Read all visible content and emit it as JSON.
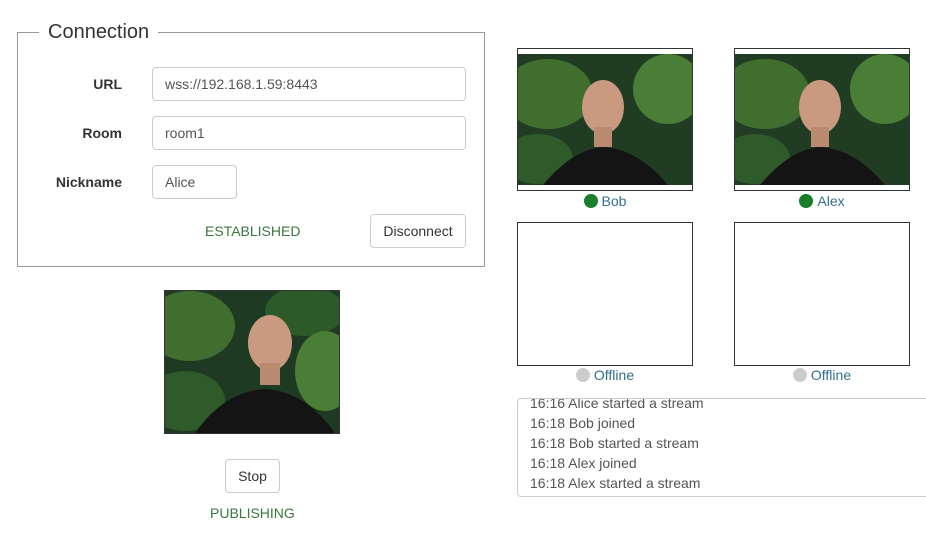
{
  "connection": {
    "legend": "Connection",
    "url_label": "URL",
    "url_value": "wss://192.168.1.59:8443",
    "room_label": "Room",
    "room_value": "room1",
    "nickname_label": "Nickname",
    "nickname_value": "Alice",
    "status": "ESTABLISHED",
    "disconnect_label": "Disconnect"
  },
  "local": {
    "stop_label": "Stop",
    "status": "PUBLISHING"
  },
  "participants": [
    {
      "name": "Bob",
      "state": "online"
    },
    {
      "name": "Alex",
      "state": "online"
    },
    {
      "name": "Offline",
      "state": "offline"
    },
    {
      "name": "Offline",
      "state": "offline"
    }
  ],
  "log": [
    "16:16 Alice started a stream",
    "16:18 Bob joined",
    "16:18 Bob started a stream",
    "16:18 Alex joined",
    "16:18 Alex started a stream"
  ],
  "colors": {
    "status_green": "#3c763d",
    "online_dot": "#1a7f2a",
    "offline_dot": "#cccccc",
    "participant_text": "#31708f"
  }
}
